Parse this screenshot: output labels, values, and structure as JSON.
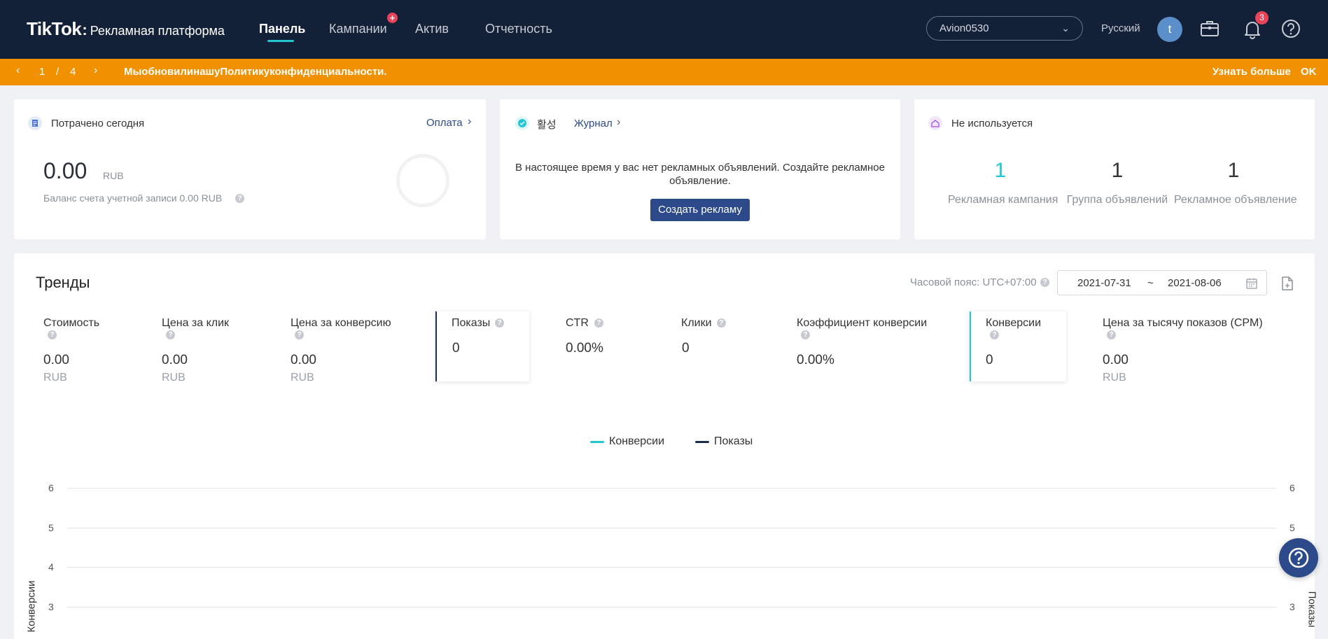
{
  "header": {
    "logo_main": "TikTok",
    "logo_colon": ":",
    "logo_sub": "Рекламная платформа",
    "nav": [
      "Панель",
      "Кампании",
      "Актив",
      "Отчетность"
    ],
    "account_name": "Avion0530",
    "language": "Русский",
    "avatar_letter": "t",
    "bell_count": "3",
    "plus_badge": "+"
  },
  "notice": {
    "page_current": "1",
    "page_sep": "/",
    "page_total": "4",
    "message": "МыобновилинашуПолитикуконфиденциальности.",
    "learn_more": "Узнать больше",
    "ok": "OK"
  },
  "spent_card": {
    "title": "Потрачено сегодня",
    "link": "Оплата",
    "amount": "0.00",
    "currency": "RUB",
    "balance": "Баланс счета учетной записи 0.00 RUB"
  },
  "status_card": {
    "status": "활성",
    "journal": "Журнал",
    "message": "В настоящее время у вас нет рекламных объявлений. Создайте рекламное объявление.",
    "create_button": "Создать рекламу"
  },
  "unused_card": {
    "title": "Не используется",
    "stats": [
      {
        "value": "1",
        "label": "Рекламная кампания"
      },
      {
        "value": "1",
        "label": "Группа объявлений"
      },
      {
        "value": "1",
        "label": "Рекламное объявление"
      }
    ]
  },
  "trends": {
    "title": "Тренды",
    "timezone": "Часовой пояс: UTC+07:00",
    "date_from": "2021-07-31",
    "date_sep": "~",
    "date_to": "2021-08-06",
    "metrics": [
      {
        "label": "Стоимость",
        "value": "0.00",
        "unit": "RUB"
      },
      {
        "label": "Цена за клик",
        "value": "0.00",
        "unit": "RUB"
      },
      {
        "label": "Цена за конверсию",
        "value": "0.00",
        "unit": "RUB"
      },
      {
        "label": "Показы",
        "value": "0"
      },
      {
        "label": "CTR",
        "value": "0.00%"
      },
      {
        "label": "Клики",
        "value": "0"
      },
      {
        "label": "Коэффициент конверсии",
        "value": "0.00%"
      },
      {
        "label": "Конверсии",
        "value": "0"
      },
      {
        "label": "Цена за тысячу показов (CPM)",
        "value": "0.00",
        "unit": "RUB"
      }
    ],
    "legend": [
      "Конверсии",
      "Показы"
    ],
    "left_ticks": [
      "6",
      "5",
      "4",
      "3"
    ],
    "right_ticks": [
      "6",
      "5",
      "4",
      "3"
    ],
    "left_axis_title": "Конверсии",
    "right_axis_title": "Показы",
    "colors": {
      "conversions": "#25c6d4",
      "impressions": "#1f2d4d"
    }
  }
}
